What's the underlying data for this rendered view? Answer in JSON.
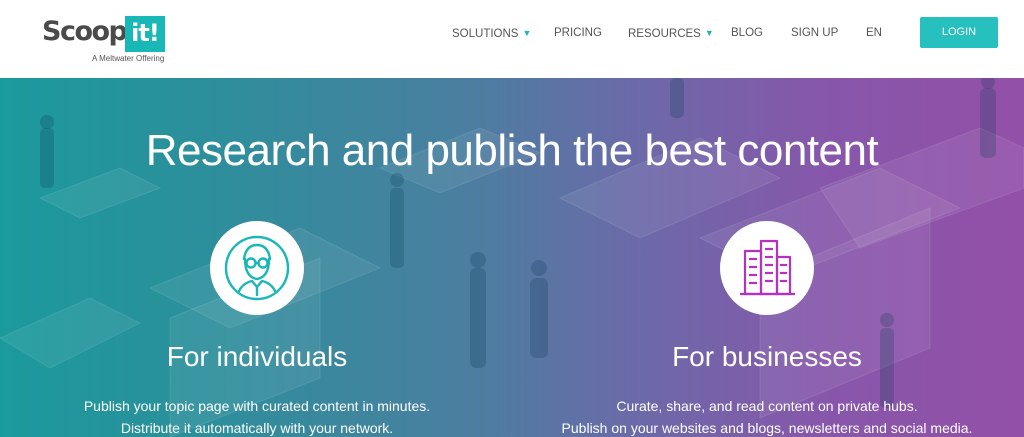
{
  "header": {
    "logo": {
      "word": "Scoop.",
      "box": "it!",
      "sub": "A Meltwater Offering"
    },
    "nav": [
      {
        "label": "SOLUTIONS",
        "has_caret": true
      },
      {
        "label": "PRICING",
        "has_caret": false
      },
      {
        "label": "RESOURCES",
        "has_caret": true
      },
      {
        "label": "BLOG",
        "has_caret": false
      },
      {
        "label": "SIGN UP",
        "has_caret": false
      },
      {
        "label": "EN",
        "has_caret": false
      }
    ],
    "login_label": "LOGIN",
    "caret_glyph": "▼"
  },
  "hero": {
    "title": "Research and publish the best content",
    "columns": [
      {
        "icon": "user-glasses-icon",
        "icon_color": "#19b8b7",
        "title": "For individuals",
        "desc": [
          "Publish your topic page with curated content in minutes.",
          "Distribute it automatically with your network."
        ]
      },
      {
        "icon": "buildings-icon",
        "icon_color": "#b531c0",
        "title": "For businesses",
        "desc": [
          "Curate, share, and read content on private hubs.",
          "Publish on your websites and blogs, newsletters and social media."
        ]
      }
    ]
  },
  "colors": {
    "accent": "#19b8b7",
    "login_bg": "#26c0bf",
    "business_icon": "#b531c0",
    "nav_text": "#555555"
  }
}
